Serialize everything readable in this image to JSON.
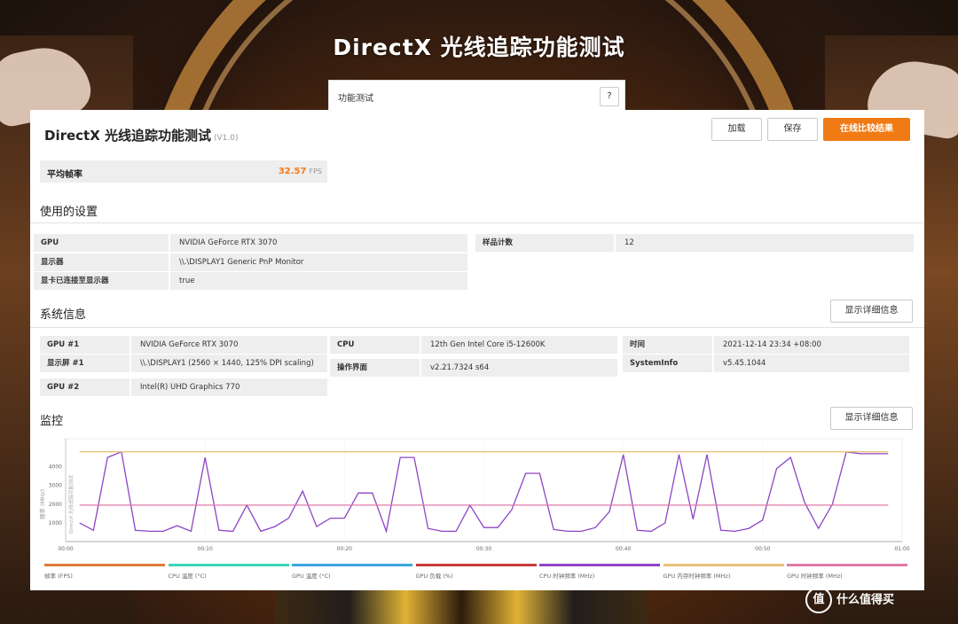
{
  "page": {
    "main_title": "DirectX 光线追踪功能测试"
  },
  "tab": {
    "label": "功能测试",
    "help": "?"
  },
  "panel": {
    "title": "DirectX 光线追踪功能测试",
    "version": "(V1.0)",
    "buttons": {
      "load": "加载",
      "save": "保存",
      "compare": "在线比较结果"
    }
  },
  "avg": {
    "label": "平均帧率",
    "value": "32.57",
    "unit": "FPS"
  },
  "settings": {
    "title": "使用的设置",
    "left": [
      {
        "key": "GPU",
        "value": "NVIDIA GeForce RTX 3070"
      },
      {
        "key": "显示器",
        "value": "\\\\.\\DISPLAY1 Generic PnP Monitor"
      },
      {
        "key": "显卡已连接至显示器",
        "value": "true"
      }
    ],
    "right": [
      {
        "key": "样品计数",
        "value": "12"
      }
    ]
  },
  "system": {
    "title": "系统信息",
    "details_button": "显示详细信息",
    "col1": [
      {
        "key": "GPU #1",
        "value": "NVIDIA GeForce RTX 3070"
      },
      {
        "key": "显示屏 #1",
        "value": "\\\\.\\DISPLAY1 (2560 × 1440, 125% DPI scaling)"
      },
      {
        "key": "GPU #2",
        "value": "Intel(R) UHD Graphics 770"
      }
    ],
    "col2": [
      {
        "key": "CPU",
        "value": "12th Gen Intel Core i5-12600K"
      },
      {
        "key": "操作界面",
        "value": "v2.21.7324 s64"
      }
    ],
    "col3": [
      {
        "key": "时间",
        "value": "2021-12-14 23:34 +08:00"
      },
      {
        "key": "SystemInfo",
        "value": "v5.45.1044"
      }
    ]
  },
  "monitor": {
    "title": "监控",
    "details_button": "显示详细信息",
    "legend": [
      {
        "name": "帧率 (FPS)",
        "color": "#e07b39"
      },
      {
        "name": "CPU 温度 (°C)",
        "color": "#3ad6b8"
      },
      {
        "name": "GPU 温度 (°C)",
        "color": "#3aa6e0"
      },
      {
        "name": "GPU 负载 (%)",
        "color": "#c73a3a"
      },
      {
        "name": "CPU 时钟频率 (MHz)",
        "color": "#8e44c6"
      },
      {
        "name": "GPU 内存时钟频率 (MHz)",
        "color": "#e8c27a"
      },
      {
        "name": "GPU 时钟频率 (MHz)",
        "color": "#e07aa8"
      }
    ]
  },
  "chart_data": {
    "type": "line",
    "ylabel": "频率 (MHz)",
    "series_label": "DirectX 光线追踪功能测试",
    "xlim": [
      0,
      60
    ],
    "ylim": [
      0,
      5500
    ],
    "yticks": [
      "1000",
      "2000",
      "3000",
      "4000"
    ],
    "ytick_values": [
      1000,
      2000,
      3000,
      4000
    ],
    "xticks": [
      "00:00",
      "00:10",
      "00:20",
      "00:30",
      "00:40",
      "00:50",
      "01:00"
    ],
    "xtick_values": [
      0,
      10,
      20,
      30,
      40,
      50,
      60
    ],
    "series": [
      {
        "name": "CPU 时钟频率 (MHz)",
        "color": "#8e44c6",
        "x": [
          1,
          2,
          3,
          4,
          5,
          6,
          7,
          8,
          9,
          10,
          11,
          12,
          13,
          14,
          15,
          16,
          17,
          18,
          19,
          20,
          21,
          22,
          23,
          24,
          25,
          26,
          27,
          28,
          29,
          30,
          31,
          32,
          33,
          34,
          35,
          36,
          37,
          38,
          39,
          40,
          41,
          42,
          43,
          44,
          45,
          46,
          47,
          48,
          49,
          50,
          51,
          52,
          53,
          54,
          55,
          56,
          57,
          58,
          59
        ],
        "y": [
          1000,
          600,
          4500,
          4800,
          600,
          550,
          550,
          850,
          550,
          4500,
          600,
          550,
          1950,
          550,
          800,
          1250,
          2700,
          800,
          1250,
          1250,
          2600,
          2600,
          550,
          4500,
          4500,
          700,
          550,
          550,
          1950,
          750,
          750,
          1700,
          3650,
          3650,
          650,
          550,
          550,
          750,
          1600,
          4650,
          600,
          550,
          1000,
          4650,
          1200,
          4650,
          600,
          550,
          700,
          1150,
          3900,
          4500,
          2100,
          700,
          2000,
          4800,
          4700,
          4700,
          4700
        ]
      },
      {
        "name": "GPU 内存时钟频率 (MHz)",
        "color": "#e8c27a",
        "x": [
          1,
          59
        ],
        "y": [
          4801,
          4801
        ]
      },
      {
        "name": "GPU 时钟频率 (MHz)",
        "color": "#e07aa8",
        "x": [
          1,
          59
        ],
        "y": [
          1950,
          1950
        ]
      }
    ]
  }
}
